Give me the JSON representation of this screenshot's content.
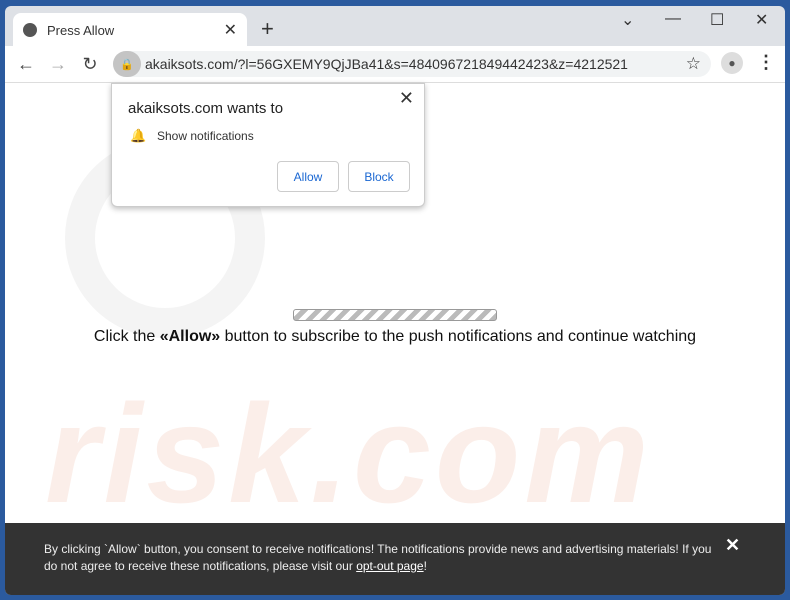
{
  "tab": {
    "title": "Press Allow"
  },
  "address": {
    "url": "akaiksots.com/?l=56GXEMY9QjJBa41&s=484096721849442423&z=4212521"
  },
  "popup": {
    "title": "akaiksots.com wants to",
    "permission": "Show notifications",
    "allow": "Allow",
    "block": "Block"
  },
  "page": {
    "message_pre": "Click the ",
    "message_bold": "«Allow»",
    "message_post": " button to subscribe to the push notifications and continue watching",
    "watermark": "risk.com"
  },
  "footer": {
    "text": "By clicking `Allow` button, you consent to receive notifications! The notifications provide news and advertising materials! If you do not agree to receive these notifications, please visit our ",
    "link": "opt-out page",
    "end": "!"
  }
}
